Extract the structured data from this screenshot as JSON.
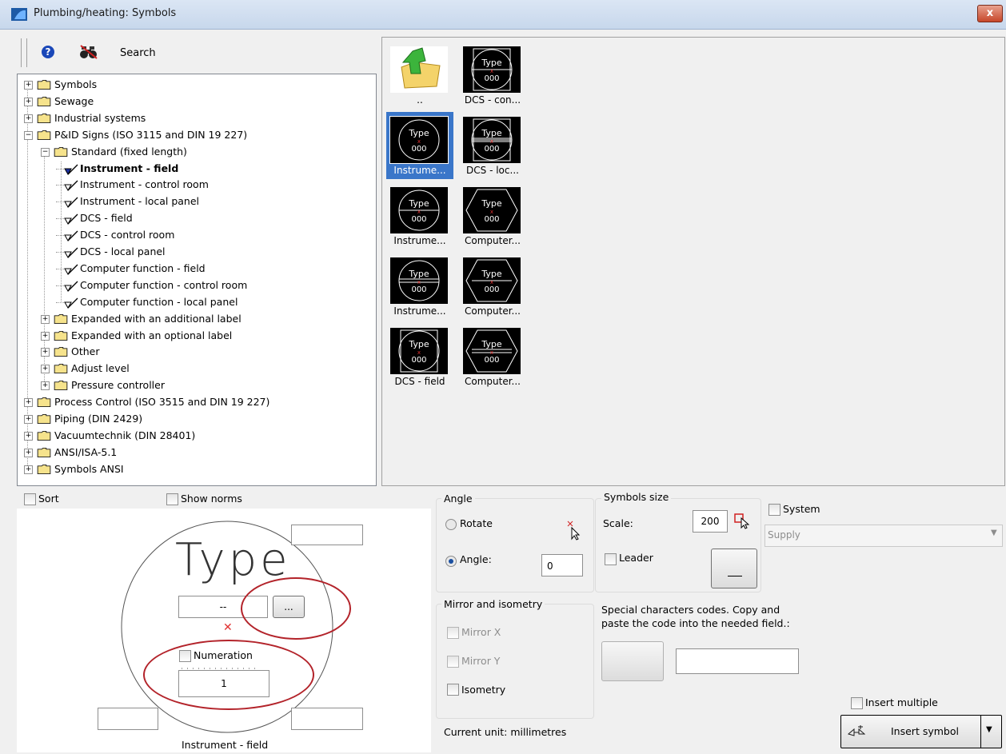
{
  "window": {
    "title": "Plumbing/heating: Symbols",
    "close": "x"
  },
  "toolbar": {
    "help": "?",
    "search": "Search"
  },
  "tree": {
    "items": [
      {
        "label": "Symbols",
        "level": 0,
        "type": "folder",
        "expander": "+"
      },
      {
        "label": "Sewage",
        "level": 0,
        "type": "folder",
        "expander": "+"
      },
      {
        "label": "Industrial systems",
        "level": 0,
        "type": "folder",
        "expander": "+"
      },
      {
        "label": "P&ID Signs (ISO 3115 and DIN 19 227)",
        "level": 0,
        "type": "folder",
        "expander": "−"
      },
      {
        "label": "Standard (fixed length)",
        "level": 1,
        "type": "folder",
        "expander": "−"
      },
      {
        "label": "Instrument - field",
        "level": 2,
        "type": "symbol",
        "bold": true
      },
      {
        "label": "Instrument - control room",
        "level": 2,
        "type": "symbol"
      },
      {
        "label": "Instrument - local panel",
        "level": 2,
        "type": "symbol"
      },
      {
        "label": "DCS - field",
        "level": 2,
        "type": "symbol"
      },
      {
        "label": "DCS - control room",
        "level": 2,
        "type": "symbol"
      },
      {
        "label": "DCS - local panel",
        "level": 2,
        "type": "symbol"
      },
      {
        "label": "Computer function - field",
        "level": 2,
        "type": "symbol"
      },
      {
        "label": "Computer function - control room",
        "level": 2,
        "type": "symbol"
      },
      {
        "label": "Computer function - local panel",
        "level": 2,
        "type": "symbol"
      },
      {
        "label": "Expanded with an additional label",
        "level": 1,
        "type": "folder",
        "expander": "+"
      },
      {
        "label": "Expanded with an optional label",
        "level": 1,
        "type": "folder",
        "expander": "+"
      },
      {
        "label": "Other",
        "level": 1,
        "type": "folder",
        "expander": "+"
      },
      {
        "label": "Adjust level",
        "level": 1,
        "type": "folder",
        "expander": "+"
      },
      {
        "label": "Pressure controller",
        "level": 1,
        "type": "folder",
        "expander": "+"
      },
      {
        "label": "Process Control (ISO 3515 and DIN 19 227)",
        "level": 0,
        "type": "folder",
        "expander": "+"
      },
      {
        "label": "Piping (DIN 2429)",
        "level": 0,
        "type": "folder",
        "expander": "+"
      },
      {
        "label": "Vacuumtechnik (DIN 28401)",
        "level": 0,
        "type": "folder",
        "expander": "+"
      },
      {
        "label": "ANSI/ISA-5.1",
        "level": 0,
        "type": "folder",
        "expander": "+"
      },
      {
        "label": "Symbols ANSI",
        "level": 0,
        "type": "folder",
        "expander": "+"
      }
    ]
  },
  "grid": {
    "items": [
      {
        "caption": "..",
        "kind": "up-folder"
      },
      {
        "caption": "DCS - con...",
        "kind": "dcs-circle-square",
        "top": "Type",
        "bottom": "000"
      },
      {
        "caption": "Instrume...",
        "kind": "circle",
        "top": "Type",
        "bottom": "000",
        "selected": true
      },
      {
        "caption": "DCS - loc...",
        "kind": "dcs-circle-square-double",
        "top": "Type",
        "bottom": "000"
      },
      {
        "caption": "Instrume...",
        "kind": "circle-line",
        "top": "Type",
        "bottom": "000"
      },
      {
        "caption": "Computer...",
        "kind": "hexagon",
        "top": "Type",
        "bottom": "000"
      },
      {
        "caption": "Instrume...",
        "kind": "circle-double-line",
        "top": "Type",
        "bottom": "000"
      },
      {
        "caption": "Computer...",
        "kind": "hexagon-line",
        "top": "Type",
        "bottom": "000"
      },
      {
        "caption": "DCS - field",
        "kind": "dcs-circle-square-plain",
        "top": "Type",
        "bottom": "000"
      },
      {
        "caption": "Computer...",
        "kind": "hexagon-double",
        "top": "Type",
        "bottom": "000"
      }
    ]
  },
  "options": {
    "sort": "Sort",
    "show_norms": "Show norms"
  },
  "preview": {
    "type_text": "Type",
    "field_value": "--",
    "browse": "...",
    "numeration": "Numeration",
    "number": "1",
    "caption": "Instrument - field"
  },
  "angle": {
    "title": "Angle",
    "rotate": "Rotate",
    "angle": "Angle:",
    "value": "0"
  },
  "size": {
    "title": "Symbols size",
    "scale": "Scale:",
    "scale_value": "200",
    "leader": "Leader"
  },
  "system": {
    "label": "System",
    "select": "Supply"
  },
  "mirror": {
    "title": "Mirror and isometry",
    "mirror_x": "Mirror X",
    "mirror_y": "Mirror Y",
    "isometry": "Isometry"
  },
  "special": {
    "text": "Special characters codes. Copy and paste the code into the needed field.:"
  },
  "insert": {
    "multiple": "Insert multiple",
    "button": "Insert symbol"
  },
  "unit": {
    "text": "Current unit: millimetres"
  },
  "colors": {
    "accent": "#3a76c9",
    "highlight_ring": "#b3232a",
    "folder": "#f6e38c"
  }
}
